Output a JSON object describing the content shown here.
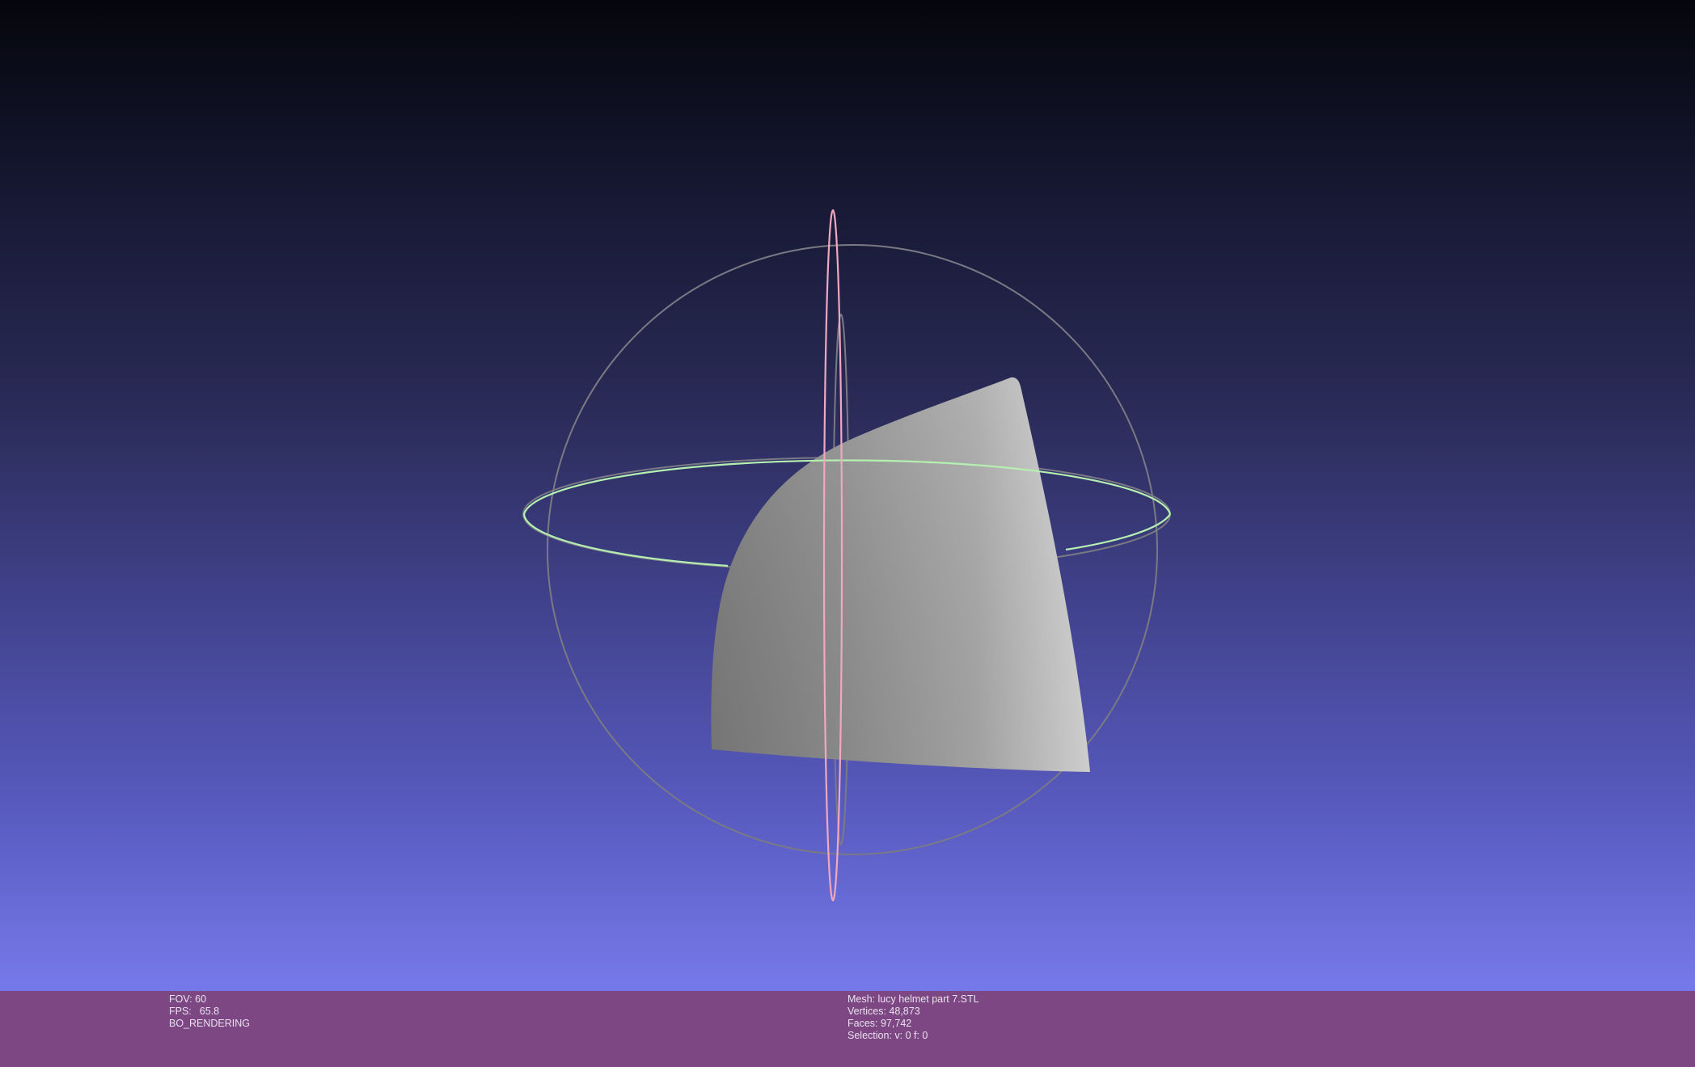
{
  "viewer": {
    "background_top": "#05060b",
    "background_bottom": "#7678ea",
    "info_bar_color": "#7d4784",
    "trackball_colors": {
      "outline": "#7a7a85",
      "horizontal_ring": "#b6f0b0",
      "vertical_ring": "#f0a8c0"
    },
    "mesh_color": "#a8a8a8"
  },
  "status_left": {
    "fov_label": "FOV: 60",
    "fps_label": "FPS:",
    "fps_value": "65.8",
    "render_mode": "BO_RENDERING"
  },
  "status_right": {
    "mesh": "Mesh: lucy helmet part 7.STL",
    "vertices": "Vertices: 48,873",
    "faces": "Faces: 97,742",
    "selection": "Selection: v: 0 f: 0"
  }
}
